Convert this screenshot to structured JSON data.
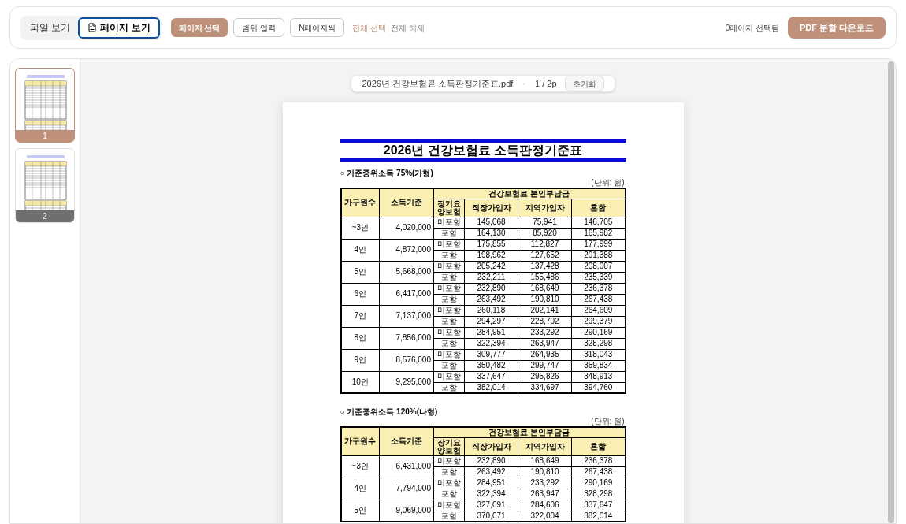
{
  "toolbar": {
    "view_tabs": [
      {
        "label": "파일 보기",
        "selected": false
      },
      {
        "label": "페이지 보기",
        "selected": true
      }
    ],
    "modes": [
      {
        "label": "페이지 선택",
        "selected": true
      },
      {
        "label": "범위 입력",
        "selected": false
      },
      {
        "label": "N페이지씩",
        "selected": false
      }
    ],
    "select_all": "전체 선택",
    "deselect_all": "전체 해제",
    "selection_count": "0페이지 선택됨",
    "download_button": "PDF 분할 다운로드"
  },
  "thumbnails": [
    {
      "label": "1",
      "current": true
    },
    {
      "label": "2",
      "current": false
    }
  ],
  "viewer": {
    "file_name": "2026년 건강보험료 소득판정기준표.pdf",
    "separator": "·",
    "page_indicator": "1 / 2p",
    "reset_button": "초기화"
  },
  "document": {
    "title": "2026년 건강보험료 소득판정기준표",
    "sections": [
      {
        "heading": "○ 기준중위소득 75%(가형)",
        "unit": "(단위: 원)",
        "columns": {
          "household": "가구원수",
          "income": "소득기준",
          "group": "건강보험료 본인부담금",
          "ltc": "장기요양보험",
          "employee": "직장가입자",
          "regional": "지역가입자",
          "mixed": "혼합"
        },
        "groups": [
          {
            "household": "~3인",
            "income": "4,020,000",
            "rows": [
              [
                "미포함",
                "145,068",
                "75,941",
                "146,705"
              ],
              [
                "포함",
                "164,130",
                "85,920",
                "165,982"
              ]
            ]
          },
          {
            "household": "4인",
            "income": "4,872,000",
            "rows": [
              [
                "미포함",
                "175,855",
                "112,827",
                "177,999"
              ],
              [
                "포함",
                "198,962",
                "127,652",
                "201,388"
              ]
            ]
          },
          {
            "household": "5인",
            "income": "5,668,000",
            "rows": [
              [
                "미포함",
                "205,242",
                "137,428",
                "208,007"
              ],
              [
                "포함",
                "232,211",
                "155,486",
                "235,339"
              ]
            ]
          },
          {
            "household": "6인",
            "income": "6,417,000",
            "rows": [
              [
                "미포함",
                "232,890",
                "168,649",
                "236,378"
              ],
              [
                "포함",
                "263,492",
                "190,810",
                "267,438"
              ]
            ]
          },
          {
            "household": "7인",
            "income": "7,137,000",
            "rows": [
              [
                "미포함",
                "260,118",
                "202,141",
                "264,609"
              ],
              [
                "포함",
                "294,297",
                "228,702",
                "299,379"
              ]
            ]
          },
          {
            "household": "8인",
            "income": "7,856,000",
            "rows": [
              [
                "미포함",
                "284,951",
                "233,292",
                "290,169"
              ],
              [
                "포함",
                "322,394",
                "263,947",
                "328,298"
              ]
            ]
          },
          {
            "household": "9인",
            "income": "8,576,000",
            "rows": [
              [
                "미포함",
                "309,777",
                "264,935",
                "318,043"
              ],
              [
                "포함",
                "350,482",
                "299,747",
                "359,834"
              ]
            ]
          },
          {
            "household": "10인",
            "income": "9,295,000",
            "rows": [
              [
                "미포함",
                "337,647",
                "295,826",
                "348,913"
              ],
              [
                "포함",
                "382,014",
                "334,697",
                "394,760"
              ]
            ]
          }
        ]
      },
      {
        "heading": "○ 기준중위소득 120%(나형)",
        "unit": "(단위: 원)",
        "columns": {
          "household": "가구원수",
          "income": "소득기준",
          "group": "건강보험료 본인부담금",
          "ltc": "장기요양보험",
          "employee": "직장가입자",
          "regional": "지역가입자",
          "mixed": "혼합"
        },
        "groups": [
          {
            "household": "~3인",
            "income": "6,431,000",
            "rows": [
              [
                "미포함",
                "232,890",
                "168,649",
                "236,378"
              ],
              [
                "포함",
                "263,492",
                "190,810",
                "267,438"
              ]
            ]
          },
          {
            "household": "4인",
            "income": "7,794,000",
            "rows": [
              [
                "미포함",
                "284,951",
                "233,292",
                "290,169"
              ],
              [
                "포함",
                "322,394",
                "263,947",
                "328,298"
              ]
            ]
          },
          {
            "household": "5인",
            "income": "9,069,000",
            "rows": [
              [
                "미포함",
                "327,091",
                "284,606",
                "337,647"
              ],
              [
                "포함",
                "370,071",
                "322,004",
                "382,014"
              ]
            ]
          }
        ]
      }
    ]
  }
}
